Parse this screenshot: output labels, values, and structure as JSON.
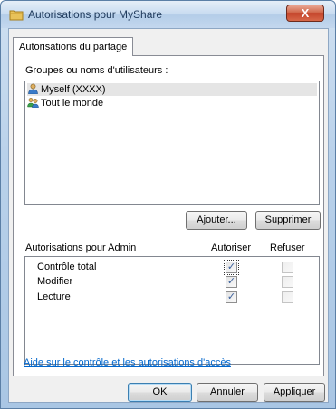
{
  "window": {
    "title": "Autorisations pour MyShare",
    "close_label": "X"
  },
  "tab": {
    "label": "Autorisations du partage"
  },
  "groups": {
    "label": "Groupes ou noms d'utilisateurs :",
    "items": [
      {
        "label": "Myself (XXXX)",
        "icon": "user-icon",
        "selected": true
      },
      {
        "label": "Tout le monde",
        "icon": "users-group-icon",
        "selected": false
      }
    ]
  },
  "buttons": {
    "add": "Ajouter...",
    "remove": "Supprimer",
    "ok": "OK",
    "cancel": "Annuler",
    "apply": "Appliquer"
  },
  "permissions": {
    "label": "Autorisations pour Admin",
    "col_allow": "Autoriser",
    "col_deny": "Refuser",
    "rows": [
      {
        "label": "Contrôle total",
        "allow": true,
        "deny": false
      },
      {
        "label": "Modifier",
        "allow": true,
        "deny": false
      },
      {
        "label": "Lecture",
        "allow": true,
        "deny": false
      }
    ]
  },
  "help_link": "Aide sur le contrôle et les autorisations d'accès",
  "colors": {
    "link": "#0066cc",
    "title_text": "#1e395b",
    "close_button": "#c4442a"
  }
}
